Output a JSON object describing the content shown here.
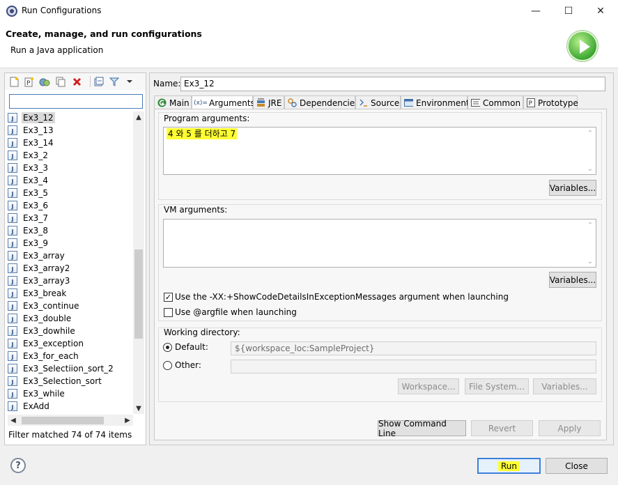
{
  "window": {
    "title": "Run Configurations",
    "minimize": "—",
    "maximize": "☐",
    "close": "✕"
  },
  "header": {
    "title": "Create, manage, and run configurations",
    "subtitle": "Run a Java application"
  },
  "left": {
    "filter_placeholder": "",
    "items": [
      "Ex3_12",
      "Ex3_13",
      "Ex3_14",
      "Ex3_2",
      "Ex3_3",
      "Ex3_4",
      "Ex3_5",
      "Ex3_6",
      "Ex3_7",
      "Ex3_8",
      "Ex3_9",
      "Ex3_array",
      "Ex3_array2",
      "Ex3_array3",
      "Ex3_break",
      "Ex3_continue",
      "Ex3_double",
      "Ex3_dowhile",
      "Ex3_exception",
      "Ex3_for_each",
      "Ex3_Selectiion_sort_2",
      "Ex3_Selection_sort",
      "Ex3_while",
      "ExAdd"
    ],
    "selected": "Ex3_12",
    "status": "Filter matched 74 of 74 items"
  },
  "name": {
    "label": "Name:",
    "value": "Ex3_12"
  },
  "tabs": [
    {
      "label": "Main",
      "icon": "main-tab-icon"
    },
    {
      "label": "Arguments",
      "icon": "arguments-tab-icon"
    },
    {
      "label": "JRE",
      "icon": "jre-tab-icon"
    },
    {
      "label": "Dependencies",
      "icon": "dependencies-tab-icon"
    },
    {
      "label": "Source",
      "icon": "source-tab-icon"
    },
    {
      "label": "Environment",
      "icon": "environment-tab-icon"
    },
    {
      "label": "Common",
      "icon": "common-tab-icon"
    },
    {
      "label": "Prototype",
      "icon": "prototype-tab-icon"
    }
  ],
  "active_tab": "Arguments",
  "arguments": {
    "program_label": "Program arguments:",
    "program_value": "4 와 5 를 더하고 7",
    "variables": "Variables...",
    "vm_label": "VM arguments:",
    "vm_value": "",
    "show_code_details": {
      "label": "Use the -XX:+ShowCodeDetailsInExceptionMessages argument when launching",
      "checked": true
    },
    "use_argfile": {
      "label": "Use @argfile when launching",
      "checked": false
    },
    "working_dir_label": "Working directory:",
    "default_label": "Default:",
    "default_value": "${workspace_loc:SampleProject}",
    "other_label": "Other:",
    "other_value": "",
    "workspace_btn": "Workspace...",
    "filesystem_btn": "File System...",
    "variables_btn": "Variables..."
  },
  "actions": {
    "show_command_line": "Show Command Line",
    "revert": "Revert",
    "apply": "Apply"
  },
  "footer": {
    "help": "?",
    "run": "Run",
    "close": "Close"
  },
  "colors": {
    "highlight": "#ffff33",
    "accent": "#3d7edb"
  }
}
